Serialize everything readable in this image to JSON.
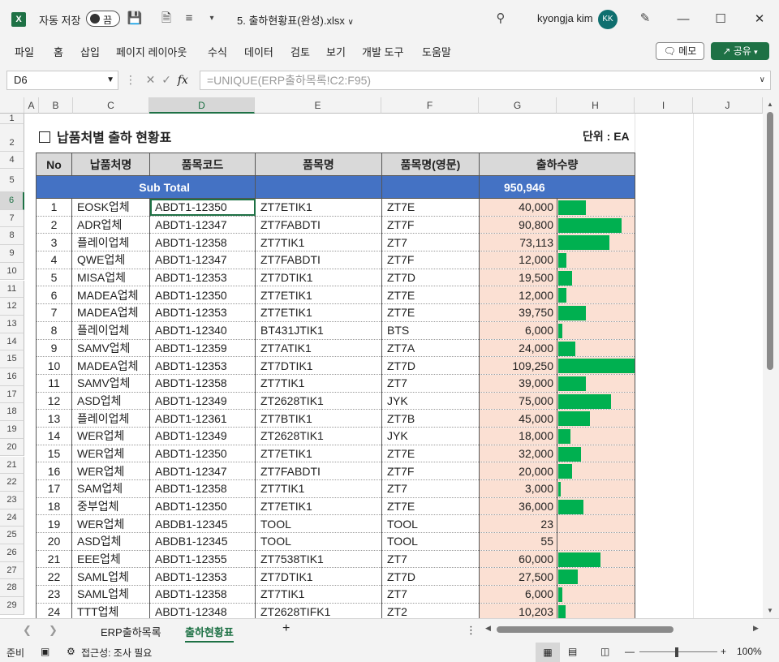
{
  "titlebar": {
    "app_icon": "excel-icon",
    "autosave_label": "자동 저장",
    "autosave_state": "끔",
    "filename": "5. 출하현황표(완성).xlsx",
    "user": "kyongja kim",
    "avatar_initials": "KK"
  },
  "ribbon": {
    "tabs": [
      "파일",
      "홈",
      "삽입",
      "페이지 레이아웃",
      "수식",
      "데이터",
      "검토",
      "보기",
      "개발 도구",
      "도움말"
    ],
    "memo": "메모",
    "share": "공유"
  },
  "formula_bar": {
    "name_box": "D6",
    "formula": "=UNIQUE(ERP출하목록!C2:F95)"
  },
  "columns": [
    "A",
    "B",
    "C",
    "D",
    "E",
    "F",
    "G",
    "H",
    "I",
    "J"
  ],
  "rows": [
    "1",
    "2",
    "4",
    "5",
    "6",
    "7",
    "8",
    "9",
    "10",
    "11",
    "12",
    "13",
    "14",
    "15",
    "16",
    "17",
    "18",
    "19",
    "20",
    "21",
    "22",
    "23",
    "24",
    "25",
    "26",
    "27",
    "28",
    "29"
  ],
  "sheet": {
    "title": "납품처별 출하 현황표",
    "unit": "단위 : EA",
    "headers": [
      "No",
      "납품처명",
      "품목코드",
      "품목명",
      "품목명(영문)",
      "출하수량"
    ],
    "subtotal_label": "Sub Total",
    "subtotal_value": "950,946",
    "max_qty": 109250,
    "records": [
      {
        "no": "1",
        "vendor": "EOSK업체",
        "code": "ABDT1-12350",
        "item": "ZT7ETIK1",
        "item_en": "ZT7E",
        "qty": "40,000",
        "qty_num": 40000
      },
      {
        "no": "2",
        "vendor": "ADR업체",
        "code": "ABDT1-12347",
        "item": "ZT7FABDTI",
        "item_en": "ZT7F",
        "qty": "90,800",
        "qty_num": 90800
      },
      {
        "no": "3",
        "vendor": "플레이업체",
        "code": "ABDT1-12358",
        "item": "ZT7TIK1",
        "item_en": "ZT7",
        "qty": "73,113",
        "qty_num": 73113
      },
      {
        "no": "4",
        "vendor": "QWE업체",
        "code": "ABDT1-12347",
        "item": "ZT7FABDTI",
        "item_en": "ZT7F",
        "qty": "12,000",
        "qty_num": 12000
      },
      {
        "no": "5",
        "vendor": "MISA업체",
        "code": "ABDT1-12353",
        "item": "ZT7DTIK1",
        "item_en": "ZT7D",
        "qty": "19,500",
        "qty_num": 19500
      },
      {
        "no": "6",
        "vendor": "MADEA업체",
        "code": "ABDT1-12350",
        "item": "ZT7ETIK1",
        "item_en": "ZT7E",
        "qty": "12,000",
        "qty_num": 12000
      },
      {
        "no": "7",
        "vendor": "MADEA업체",
        "code": "ABDT1-12353",
        "item": "ZT7ETIK1",
        "item_en": "ZT7E",
        "qty": "39,750",
        "qty_num": 39750
      },
      {
        "no": "8",
        "vendor": "플레이업체",
        "code": "ABDT1-12340",
        "item": "BT431JTIK1",
        "item_en": "BTS",
        "qty": "6,000",
        "qty_num": 6000
      },
      {
        "no": "9",
        "vendor": "SAMV업체",
        "code": "ABDT1-12359",
        "item": "ZT7ATIK1",
        "item_en": "ZT7A",
        "qty": "24,000",
        "qty_num": 24000
      },
      {
        "no": "10",
        "vendor": "MADEA업체",
        "code": "ABDT1-12353",
        "item": "ZT7DTIK1",
        "item_en": "ZT7D",
        "qty": "109,250",
        "qty_num": 109250
      },
      {
        "no": "11",
        "vendor": "SAMV업체",
        "code": "ABDT1-12358",
        "item": "ZT7TIK1",
        "item_en": "ZT7",
        "qty": "39,000",
        "qty_num": 39000
      },
      {
        "no": "12",
        "vendor": "ASD업체",
        "code": "ABDT1-12349",
        "item": "ZT2628TIK1",
        "item_en": "JYK",
        "qty": "75,000",
        "qty_num": 75000
      },
      {
        "no": "13",
        "vendor": "플레이업체",
        "code": "ABDT1-12361",
        "item": "ZT7BTIK1",
        "item_en": "ZT7B",
        "qty": "45,000",
        "qty_num": 45000
      },
      {
        "no": "14",
        "vendor": "WER업체",
        "code": "ABDT1-12349",
        "item": "ZT2628TIK1",
        "item_en": "JYK",
        "qty": "18,000",
        "qty_num": 18000
      },
      {
        "no": "15",
        "vendor": "WER업체",
        "code": "ABDT1-12350",
        "item": "ZT7ETIK1",
        "item_en": "ZT7E",
        "qty": "32,000",
        "qty_num": 32000
      },
      {
        "no": "16",
        "vendor": "WER업체",
        "code": "ABDT1-12347",
        "item": "ZT7FABDTI",
        "item_en": "ZT7F",
        "qty": "20,000",
        "qty_num": 20000
      },
      {
        "no": "17",
        "vendor": "SAM업체",
        "code": "ABDT1-12358",
        "item": "ZT7TIK1",
        "item_en": "ZT7",
        "qty": "3,000",
        "qty_num": 3000
      },
      {
        "no": "18",
        "vendor": "중부업체",
        "code": "ABDT1-12350",
        "item": "ZT7ETIK1",
        "item_en": "ZT7E",
        "qty": "36,000",
        "qty_num": 36000
      },
      {
        "no": "19",
        "vendor": "WER업체",
        "code": "ABDB1-12345",
        "item": "TOOL",
        "item_en": "TOOL",
        "qty": "23",
        "qty_num": 23
      },
      {
        "no": "20",
        "vendor": "ASD업체",
        "code": "ABDB1-12345",
        "item": "TOOL",
        "item_en": "TOOL",
        "qty": "55",
        "qty_num": 55
      },
      {
        "no": "21",
        "vendor": "EEE업체",
        "code": "ABDT1-12355",
        "item": "ZT7538TIK1",
        "item_en": "ZT7",
        "qty": "60,000",
        "qty_num": 60000
      },
      {
        "no": "22",
        "vendor": "SAML업체",
        "code": "ABDT1-12353",
        "item": "ZT7DTIK1",
        "item_en": "ZT7D",
        "qty": "27,500",
        "qty_num": 27500
      },
      {
        "no": "23",
        "vendor": "SAML업체",
        "code": "ABDT1-12358",
        "item": "ZT7TIK1",
        "item_en": "ZT7",
        "qty": "6,000",
        "qty_num": 6000
      },
      {
        "no": "24",
        "vendor": "TTT업체",
        "code": "ABDT1-12348",
        "item": "ZT2628TIFK1",
        "item_en": "ZT2",
        "qty": "10,203",
        "qty_num": 10203
      }
    ]
  },
  "sheet_tabs": [
    "ERP출하목록",
    "출하현황표"
  ],
  "active_tab": "출하현황표",
  "status": {
    "ready": "준비",
    "accessibility": "접근성: 조사 필요",
    "zoom": "100%"
  },
  "colors": {
    "accent": "#1e7145",
    "header_fill": "#d9d9d9",
    "subtotal_fill": "#4472c4",
    "qty_fill": "#fbe0d3",
    "databar": "#00b050"
  }
}
